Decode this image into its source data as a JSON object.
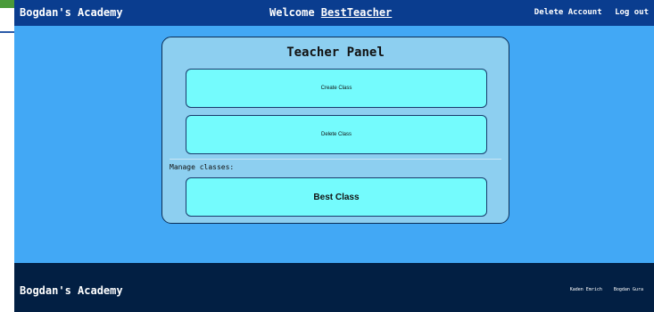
{
  "navbar": {
    "brand": "Bogdan's Academy",
    "welcome_prefix": "Welcome ",
    "username": "BestTeacher",
    "delete_account": "Delete Account",
    "logout": "Log out"
  },
  "panel": {
    "title": "Teacher Panel",
    "create_class": "Create Class",
    "delete_class": "Delete Class",
    "manage_label": "Manage classes:",
    "classes": [
      "Best Class"
    ]
  },
  "footer": {
    "brand": "Bogdan's Academy",
    "credits": [
      "Kaden Emrich",
      "Bogdan Gura"
    ]
  },
  "colors": {
    "page_bg": "#42a8f5",
    "navbar": "#0a3d8f",
    "panel": "#8dcff0",
    "button": "#74fbfd",
    "footer": "#021f43"
  }
}
